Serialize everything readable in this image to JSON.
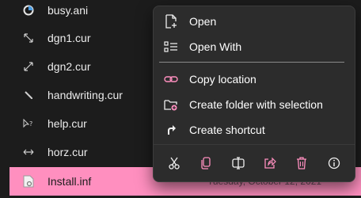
{
  "files": [
    {
      "name": "busy.ani",
      "icon": "busy-cursor-icon"
    },
    {
      "name": "dgn1.cur",
      "icon": "diagonal-resize-icon"
    },
    {
      "name": "dgn2.cur",
      "icon": "diagonal-resize-icon"
    },
    {
      "name": "handwriting.cur",
      "icon": "pen-cursor-icon"
    },
    {
      "name": "help.cur",
      "icon": "help-cursor-icon"
    },
    {
      "name": "horz.cur",
      "icon": "horizontal-resize-icon"
    },
    {
      "name": "Install.inf",
      "icon": "settings-file-icon",
      "date": "Tuesday, October 12, 2021"
    }
  ],
  "context_menu": {
    "items": [
      {
        "label": "Open",
        "icon": "open-file-icon"
      },
      {
        "label": "Open With",
        "icon": "open-with-icon"
      },
      {
        "label": "Copy location",
        "icon": "link-icon"
      },
      {
        "label": "Create folder with selection",
        "icon": "new-folder-icon"
      },
      {
        "label": "Create shortcut",
        "icon": "shortcut-arrow-icon"
      }
    ],
    "actions": [
      "cut-icon",
      "copy-icon",
      "rename-icon",
      "share-icon",
      "delete-icon",
      "properties-icon"
    ]
  },
  "colors": {
    "accent": "#ff8fbf",
    "menu_background": "#2c2c2c",
    "window_background": "#1c1c1c"
  }
}
